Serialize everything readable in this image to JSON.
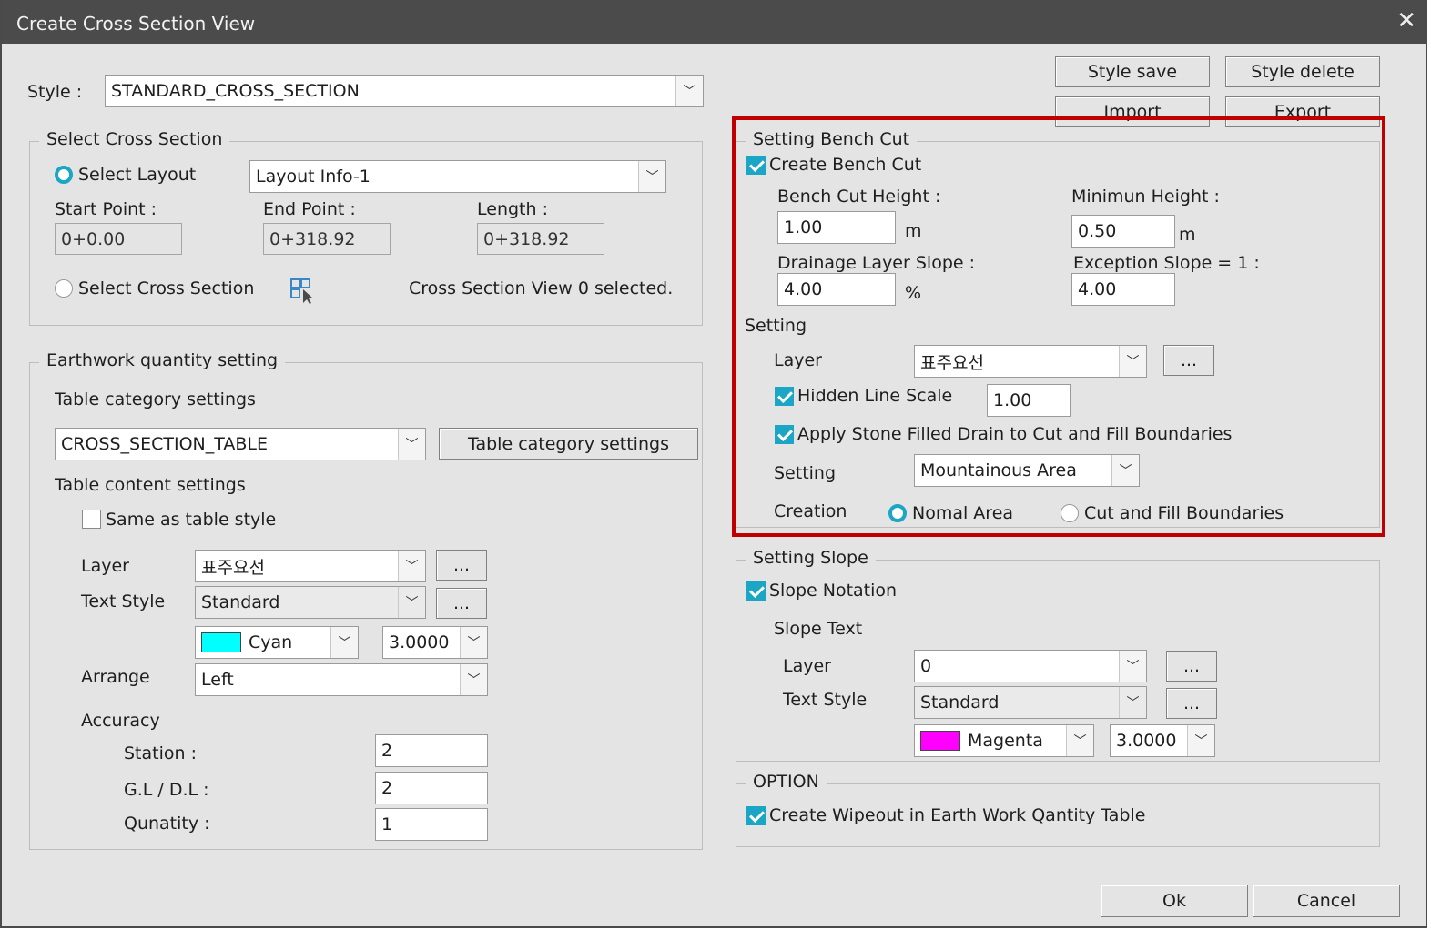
{
  "window": {
    "title": "Create Cross Section View",
    "close_glyph": "✕"
  },
  "style_row": {
    "label": "Style :",
    "value": "STANDARD_CROSS_SECTION"
  },
  "top_buttons": {
    "style_save": "Style save",
    "style_delete": "Style delete",
    "import": "Import",
    "export": "Export"
  },
  "select_cross_section": {
    "legend": "Select Cross Section",
    "select_layout_label": "Select Layout",
    "layout_value": "Layout Info-1",
    "start_point_label": "Start Point :",
    "start_point_value": "0+0.00",
    "end_point_label": "End Point :",
    "end_point_value": "0+318.92",
    "length_label": "Length :",
    "length_value": "0+318.92",
    "select_cross_section_label": "Select Cross Section",
    "status_text": "Cross Section View 0 selected."
  },
  "earthwork": {
    "legend": "Earthwork quantity setting",
    "table_category_label": "Table category settings",
    "table_value": "CROSS_SECTION_TABLE",
    "table_category_button": "Table category settings",
    "table_content_label": "Table content settings",
    "same_as_table_style": "Same as table style",
    "layer_label": "Layer",
    "layer_value": "표주요선",
    "text_style_label": "Text Style",
    "text_style_value": "Standard",
    "color_value": "Cyan",
    "color_hex": "#00ffff",
    "height_value": "3.0000",
    "arrange_label": "Arrange",
    "arrange_value": "Left",
    "accuracy_label": "Accuracy",
    "station_label": "Station :",
    "station_value": "2",
    "gl_dl_label": "G.L / D.L :",
    "gl_dl_value": "2",
    "quantity_label": "Qunatity :",
    "quantity_value": "1",
    "ellipsis": "..."
  },
  "bench_cut": {
    "legend": "Setting Bench Cut",
    "create_bench_cut": "Create Bench Cut",
    "bench_cut_height_label": "Bench Cut Height :",
    "bench_cut_height_value": "1.00",
    "bench_cut_height_unit": "m",
    "minimum_height_label": "Minimun Height :",
    "minimum_height_value": "0.50",
    "minimum_height_unit": "m",
    "drainage_slope_label": "Drainage Layer Slope :",
    "drainage_slope_value": "4.00",
    "drainage_slope_unit": "%",
    "exception_slope_label": "Exception Slope = 1 :",
    "exception_slope_value": "4.00",
    "setting_label": "Setting",
    "layer_label": "Layer",
    "layer_value": "표주요선",
    "ellipsis": "...",
    "hidden_line_scale": "Hidden Line Scale",
    "hidden_line_scale_value": "1.00",
    "apply_stone": "Apply Stone Filled Drain to Cut and Fill Boundaries",
    "setting2_label": "Setting",
    "setting2_value": "Mountainous Area",
    "creation_label": "Creation",
    "normal_area": "Nomal Area",
    "cut_fill_boundaries": "Cut and Fill Boundaries",
    "highlight_color": "#c00000"
  },
  "slope": {
    "legend": "Setting Slope",
    "slope_notation": "Slope Notation",
    "slope_text_label": "Slope Text",
    "layer_label": "Layer",
    "layer_value": "0",
    "text_style_label": "Text Style",
    "text_style_value": "Standard",
    "color_value": "Magenta",
    "color_hex": "#ff00ff",
    "height_value": "3.0000",
    "ellipsis": "..."
  },
  "option": {
    "legend": "OPTION",
    "create_wipeout": "Create Wipeout in Earth Work Qantity Table"
  },
  "footer": {
    "ok": "Ok",
    "cancel": "Cancel"
  },
  "accent_color": "#1aa6c4"
}
